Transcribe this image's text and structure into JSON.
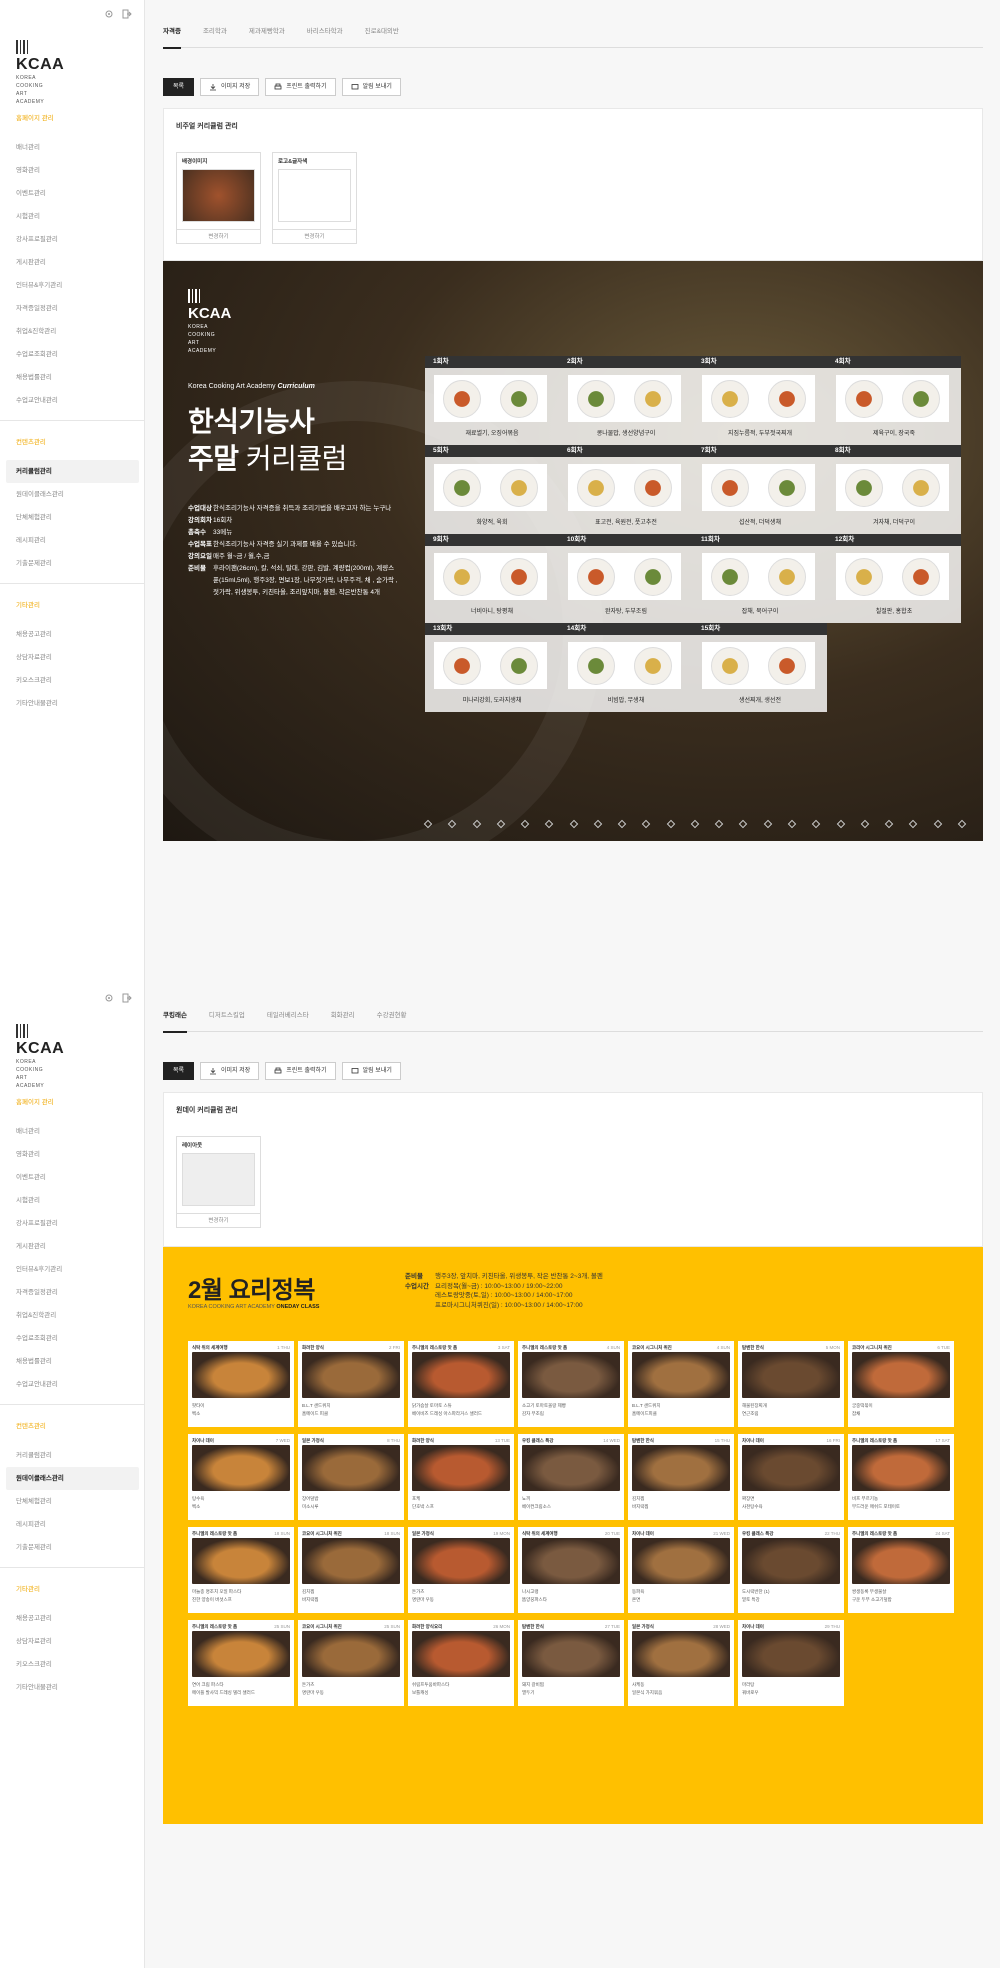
{
  "colors": {
    "accent": "#ffc000",
    "menu_section": "#f0a800",
    "dark": "#222222"
  },
  "icons": {
    "settings": "gear-icon",
    "logout": "logout-icon"
  },
  "logo": {
    "name": "KCAA",
    "sub1": "KOREA",
    "sub2": "COOKING",
    "sub3": "ART",
    "sub4": "ACADEMY"
  },
  "menu": {
    "sec1": "홈페이지 관리",
    "items1": [
      "배너관리",
      "영화관리",
      "이벤트관리",
      "시험관리",
      "강사프로필관리",
      "게시판관리",
      "인터뷰&후기관리",
      "자격증일정관리",
      "취업&진학관리",
      "수업료조회관리",
      "채용법률관리",
      "수업교안내관리"
    ],
    "sec2": "컨텐츠관리",
    "items2": [
      "커리큘럼관리",
      "원데이클래스관리",
      "단체체험관리",
      "레시피관리",
      "기출문제관리"
    ],
    "sec3": "기타관리",
    "items3": [
      "채용공고관리",
      "상담자료관리",
      "키오스크관리",
      "기타안내물관리"
    ]
  },
  "toolbar": {
    "list": "목록",
    "image": "이미지 저장",
    "print": "프린트 출력하기",
    "send": "알림 보내기"
  },
  "s1": {
    "tabs": [
      "자격증",
      "조리학과",
      "제과제빵학과",
      "바리스타학과",
      "진로&대외반"
    ],
    "panel_title": "비주얼 커리큘럼 관리",
    "thumb1": "배경이미지",
    "thumb2": "로고&글자색",
    "change": "변경하기",
    "poster": {
      "curriculum_pre": "Korea Cooking Art Academy ",
      "curriculum_b": "Curriculum",
      "title1": "한식기능사",
      "title2a": "주말 ",
      "title2b": "커리큘럼",
      "info": [
        {
          "k": "수업대상",
          "v": "한식조리기능사 자격증을 취득과 조리기법을 배우고자 하는 누구나"
        },
        {
          "k": "강의회차",
          "v": "16회차"
        },
        {
          "k": "총축수",
          "v": "33메뉴"
        },
        {
          "k": "수업목표",
          "v": "한식조리기능사 자격증 실기 과제를 배울 수 있습니다."
        },
        {
          "k": "강의요일",
          "v": "매주 월~금 / 월,수,금"
        },
        {
          "k": "준비물",
          "v": "후라이팬(26cm), 칼, 석쇠, 탈대, 강판, 김발, 계량컵(200ml), 계량스푼(15ml,5ml), 행주3장, 면보1장, 나무젓가락, 나무주걱, 채 , 숟가락 , 젓가락, 위생봉투, 키친타올, 조리앞치마, 볼펜, 작은반찬통 4개"
        }
      ],
      "sessions": [
        {
          "n": "1회차",
          "c": "재료썰기, 오징어볶음"
        },
        {
          "n": "2회차",
          "c": "콩나물밥, 생선양념구이"
        },
        {
          "n": "3회차",
          "c": "지짐누름적, 두부젓국찌개"
        },
        {
          "n": "4회차",
          "c": "제육구이, 장국죽"
        },
        {
          "n": "5회차",
          "c": "화양적, 육회"
        },
        {
          "n": "6회차",
          "c": "표고전, 육원전, 풋고추전"
        },
        {
          "n": "7회차",
          "c": "섭산적, 더덕생채"
        },
        {
          "n": "8회차",
          "c": "겨자채, 더덕구이"
        },
        {
          "n": "9회차",
          "c": "너비아니, 탕평채"
        },
        {
          "n": "10회차",
          "c": "완자탕, 두부조림"
        },
        {
          "n": "11회차",
          "c": "잡채, 북어구이"
        },
        {
          "n": "12회차",
          "c": "칠절판, 홍합초"
        },
        {
          "n": "13회차",
          "c": "미나리강회, 도라지생채"
        },
        {
          "n": "14회차",
          "c": "비빔밥, 무생채"
        },
        {
          "n": "15회차",
          "c": "생선찌개, 생선전"
        }
      ]
    }
  },
  "s2": {
    "tabs": [
      "쿠킹래슨",
      "디저트스킬업",
      "테일러베리스타",
      "회화관리",
      "수강권현황"
    ],
    "panel_title": "원데이 커리큘럼 관리",
    "thumb1": "레이아웃",
    "change": "변경하기",
    "title": "2월 요리정복",
    "sub_pre": "KOREA COOKING ART ACADEMY ",
    "sub_b": "ONEDAY CLASS",
    "info": [
      {
        "k": "준비물",
        "v": "행주3장, 앞치마, 키친타올, 위생봉투, 작은 반찬통 2~3개, 볼펜"
      },
      {
        "k": "수업시간",
        "v": "요리정복(월~금) : 10:00~13:00 / 19:00~22:00"
      },
      {
        "k": "",
        "v": "레스토랑맛중(토,일) : 10:00~13:00 / 14:00~17:00"
      },
      {
        "k": "",
        "v": "프로마시그니처퀴진(일) : 10:00~13:00 / 14:00~17:00"
      }
    ],
    "cards": [
      {
        "t": "식탁 위의 세계여행",
        "d": "1 THU",
        "m1": "팟타이",
        "m2": "벡소"
      },
      {
        "t": "화려한 양식",
        "d": "2 FRI",
        "m1": "B.L.T 샌드위치",
        "m2": "홈메이드 피클"
      },
      {
        "t": "주니엘의 레스토랑 맛 품",
        "d": "3 SAT",
        "m1": "닭가슴살 토마토 스튜",
        "m2": "베이비즈 드레싱 아스파라거스 샐러드"
      },
      {
        "t": "주니엘의 레스토랑 맛 품",
        "d": "4 SUN",
        "m1": "소고기 토마토올랑 제빵",
        "m2": "감자 무조림"
      },
      {
        "t": "코요이 시그니처 퀴진",
        "d": "4 SUN",
        "m1": "B.L.T 샌드위치",
        "m2": "홈메이드피클"
      },
      {
        "t": "탐벤한 한식",
        "d": "5 MON",
        "m1": "해물된장찌개",
        "m2": "연근조림"
      },
      {
        "t": "코리아 시그니처 퀴진",
        "d": "6 TUE",
        "m1": "궁중떡볶이",
        "m2": "잡채"
      },
      {
        "t": "차이나 데이",
        "d": "7 WED",
        "m1": "탕수육",
        "m2": "벡소"
      },
      {
        "t": "일본 가정식",
        "d": "8 THU",
        "m1": "장어덮밥",
        "m2": "미소시루"
      },
      {
        "t": "화려한 양식",
        "d": "13 TUE",
        "m1": "포케",
        "m2": "단호박 스프"
      },
      {
        "t": "우킹 클래스 특강",
        "d": "14 WED",
        "m1": "뇨끼",
        "m2": "베이컨크림소스"
      },
      {
        "t": "탐벤한 한식",
        "d": "15 THU",
        "m1": "김치찜",
        "m2": "바지락찜"
      },
      {
        "t": "차이나 데이",
        "d": "16 FRI",
        "m1": "짜장면",
        "m2": "사천탕수육"
      },
      {
        "t": "주니엘의 레스토랑 맛 품",
        "d": "17 SAT",
        "m1": "비프 부르기뇽",
        "m2": "부드러운 매쉬드 포테이토"
      },
      {
        "t": "주니엘의 레스토랑 맛 품",
        "d": "18 SUN",
        "m1": "마늘종 명조치 오일 파스타",
        "m2": "진한 양송이 버섯스프"
      },
      {
        "t": "코요이 시그니처 퀴진",
        "d": "18 SUN",
        "m1": "김치찜",
        "m2": "바지락찜"
      },
      {
        "t": "일본 가정식",
        "d": "19 MON",
        "m1": "돈가츠",
        "m2": "명란마 우동"
      },
      {
        "t": "식탁 위의 세계여행",
        "d": "20 TUE",
        "m1": "나시고랭",
        "m2": "똠양꿍파스타"
      },
      {
        "t": "차이나 데이",
        "d": "21 WED",
        "m1": "동파육",
        "m2": "온면"
      },
      {
        "t": "우킹 클래스 특강",
        "d": "22 THU",
        "m1": "도시락반찬 (1)",
        "m2": "밑토 특강"
      },
      {
        "t": "주니엘의 레스토랑 맛 품",
        "d": "24 SAT",
        "m1": "쌍생동록 무생물살",
        "m2": "구운 두부 소고기덮밥"
      },
      {
        "t": "주니엘의 레스토랑 맛 품",
        "d": "25 SUN",
        "m1": "연어 크림 파스타",
        "m2": "메이플 발사믹 드레싱 델리 샐러드"
      },
      {
        "t": "코요이 시그니처 퀴진",
        "d": "25 SUN",
        "m1": "돈가츠",
        "m2": "명란마 우동"
      },
      {
        "t": "화려한 양식요리",
        "d": "26 MON",
        "m1": "쉬림프투움바파스타",
        "m2": "보틀캐싱"
      },
      {
        "t": "탐벤한 한식",
        "d": "27 TUE",
        "m1": "돼지 갈비찜",
        "m2": "멸두기"
      },
      {
        "t": "일본 가정식",
        "d": "28 WED",
        "m1": "사케동",
        "m2": "일본식 가지볶음"
      },
      {
        "t": "차이나 데이",
        "d": "29 THU",
        "m1": "마라탕",
        "m2": "꿔바로우"
      }
    ]
  }
}
